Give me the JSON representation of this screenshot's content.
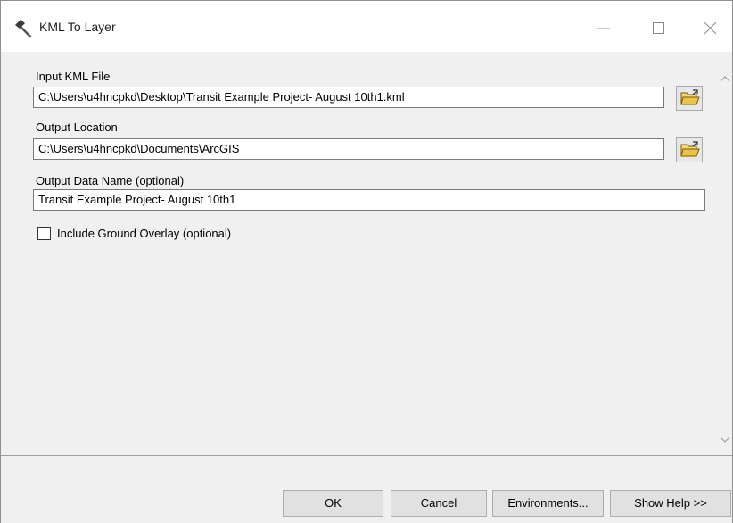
{
  "window": {
    "title": "KML To Layer",
    "icon": "hammer-icon"
  },
  "form": {
    "input_kml_label": "Input KML File",
    "input_kml_value": "C:\\Users\\u4hncpkd\\Desktop\\Transit Example Project- August 10th1.kml",
    "output_location_label": "Output Location",
    "output_location_value": "C:\\Users\\u4hncpkd\\Documents\\ArcGIS",
    "output_name_label": "Output Data Name (optional)",
    "output_name_value": "Transit Example Project- August 10th1",
    "ground_overlay_label": "Include Ground Overlay (optional)",
    "ground_overlay_checked": false,
    "browse_icon": "open-folder-icon"
  },
  "footer": {
    "ok": "OK",
    "cancel": "Cancel",
    "environments": "Environments...",
    "show_help": "Show Help >>"
  },
  "colors": {
    "window_bg": "#f0f0f0",
    "titlebar_bg": "#ffffff",
    "folder_yellow": "#e8c44a"
  }
}
